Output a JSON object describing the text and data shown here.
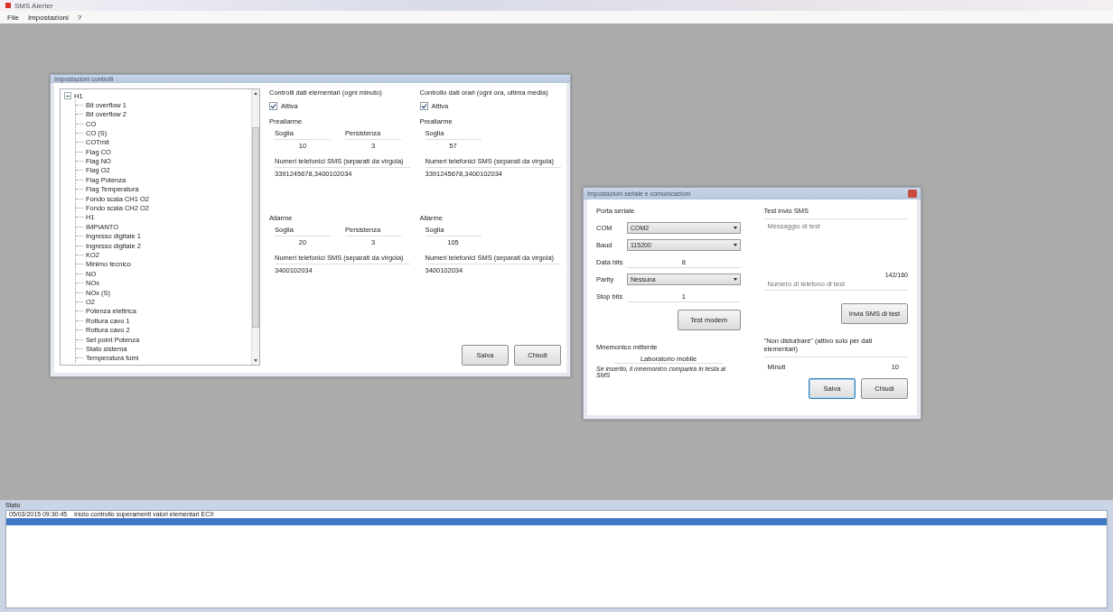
{
  "app": {
    "title": "SMS Alerter"
  },
  "menu": [
    {
      "label": "File"
    },
    {
      "label": "Impostazioni"
    },
    {
      "label": "?"
    }
  ],
  "controls_window": {
    "title": "Impostazioni controlli",
    "tree": {
      "label": "H1",
      "expanded": true,
      "children": [
        {
          "label": "Bit overflow 1"
        },
        {
          "label": "Bit overflow 2"
        },
        {
          "label": "CO"
        },
        {
          "label": "CO (S)"
        },
        {
          "label": "COTmit"
        },
        {
          "label": "Flag CO"
        },
        {
          "label": "Flag NO"
        },
        {
          "label": "Flag O2"
        },
        {
          "label": "Flag Potenza"
        },
        {
          "label": "Flag Temperatura"
        },
        {
          "label": "Fondo scala CH1 O2"
        },
        {
          "label": "Fondo scala CH2 O2"
        },
        {
          "label": "H1"
        },
        {
          "label": "IMPIANTO"
        },
        {
          "label": "Ingresso digitale 1"
        },
        {
          "label": "Ingresso digitale 2"
        },
        {
          "label": "KO2"
        },
        {
          "label": "Minimo tecnico"
        },
        {
          "label": "NO"
        },
        {
          "label": "NOx"
        },
        {
          "label": "NOx (S)"
        },
        {
          "label": "O2"
        },
        {
          "label": "Potenza elettrica"
        },
        {
          "label": "Rottura cavo 1"
        },
        {
          "label": "Rottura cavo 2"
        },
        {
          "label": "Set point Potenza"
        },
        {
          "label": "Stato sistema"
        },
        {
          "label": "Temperatura fumi"
        }
      ]
    },
    "sections": [
      {
        "title": "Controlli dati elementari (ogni minuto)",
        "active": {
          "label": "Attiva",
          "checked": true
        },
        "groups": [
          {
            "title": "Preallarme",
            "fields": [
              {
                "label": "Soglia",
                "value": "10"
              },
              {
                "label": "Persistenza",
                "value": "3"
              }
            ],
            "phones_label": "Numeri telefonici SMS (separati da virgola)",
            "phones": "3391245678,3400102034"
          },
          {
            "title": "Allarme",
            "fields": [
              {
                "label": "Soglia",
                "value": "20"
              },
              {
                "label": "Persistenza",
                "value": "3"
              }
            ],
            "phones_label": "Numeri telefonici SMS (separati da virgola)",
            "phones": "3400102034"
          }
        ]
      },
      {
        "title": "Controllo dati orari (ogni ora, ultima media)",
        "active": {
          "label": "Attiva",
          "checked": true
        },
        "groups": [
          {
            "title": "Preallarme",
            "fields": [
              {
                "label": "Soglia",
                "value": "57"
              }
            ],
            "phones_label": "Numeri telefonici SMS (separati da virgola)",
            "phones": "3391245678,3400102034"
          },
          {
            "title": "Allarme",
            "fields": [
              {
                "label": "Soglia",
                "value": "105"
              }
            ],
            "phones_label": "Numeri telefonici SMS (separati da virgola)",
            "phones": "3400102034"
          }
        ]
      }
    ],
    "buttons": [
      {
        "label": "Salva",
        "default": false
      },
      {
        "label": "Chiudi",
        "default": false
      }
    ]
  },
  "serial_window": {
    "title": "Impostazioni seriale e comunicazioni",
    "port": {
      "title": "Porta seriale",
      "rows": [
        {
          "kind": "dropdown",
          "label": "COM",
          "value": "COM2"
        },
        {
          "kind": "dropdown",
          "label": "Baud",
          "value": "115200"
        },
        {
          "kind": "field",
          "label": "Data bits",
          "value": "8"
        },
        {
          "kind": "dropdown",
          "label": "Parity",
          "value": "Nessuna"
        },
        {
          "kind": "field",
          "label": "Stop bits",
          "value": "1"
        }
      ],
      "button": "Test modem"
    },
    "sender": {
      "title": "Mnemonico mittente",
      "value": "Laboratorio mobile",
      "note": "Se inserito, il mnemonico comparirà in testa al SMS"
    },
    "test": {
      "title": "Test invio SMS",
      "message_placeholder": "Messaggio di test",
      "counter": "142/160",
      "phone_placeholder": "Numero di telefono di test",
      "button": "Invia SMS di test"
    },
    "dnd": {
      "title": "\"Non disturbare\" (attivo solo per dati elementari)",
      "label": "Minuti",
      "value": "10"
    },
    "buttons": [
      {
        "label": "Salva",
        "default": true
      },
      {
        "label": "Chiudi",
        "default": false
      }
    ]
  },
  "status": {
    "title": "Stato",
    "rows": [
      {
        "text": "05/03/2015 09:30:45    Inizio controllo superamenti valori elementari ECX",
        "selected": false
      },
      {
        "selected": true
      }
    ]
  }
}
